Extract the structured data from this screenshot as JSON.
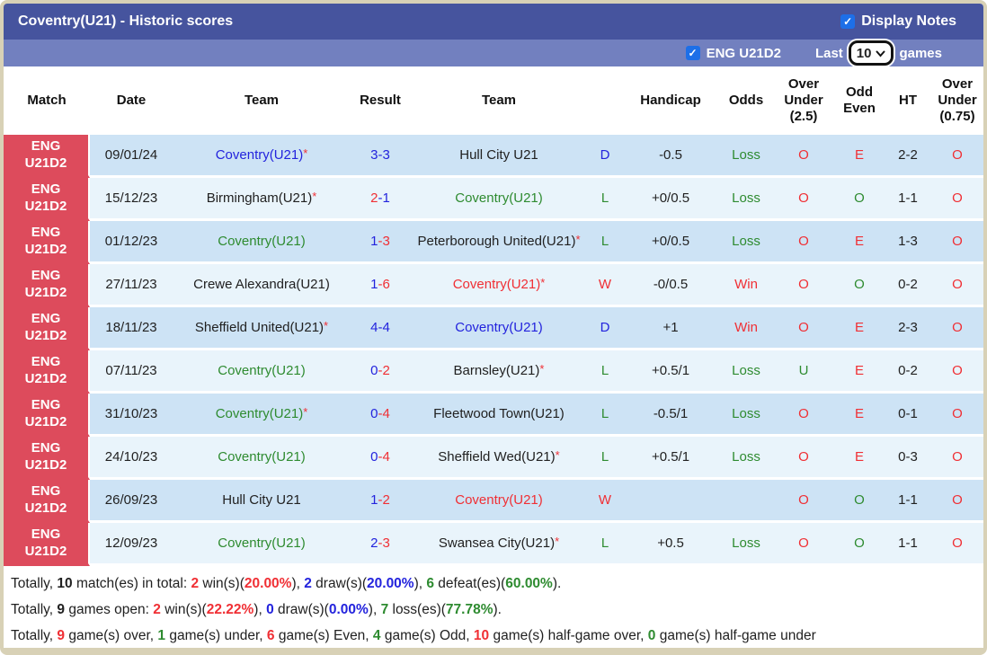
{
  "palette": {
    "red": "#f02f34",
    "green": "#2e8b30",
    "blue": "#2323dd",
    "dark": "#212121",
    "badge_bg": "#dd4b5c",
    "band_dark": "#46549e",
    "band_light": "#7280bf",
    "row_dark": "#cde3f5",
    "row_light": "#e9f4fb",
    "checkbox_blue": "#1d6fe8",
    "border_tan": "#d8d1b6"
  },
  "title_bar": {
    "title": "Coventry(U21) - Historic scores",
    "display_notes_label": "Display Notes",
    "display_notes_checked": true
  },
  "filter_bar": {
    "league_label": "ENG U21D2",
    "league_checked": true,
    "last_label": "Last",
    "games_count": "10",
    "games_label": "games"
  },
  "table": {
    "headers": [
      "Match",
      "Date",
      "Team",
      "Result",
      "Team",
      "",
      "Handicap",
      "Odds",
      "Over\nUnder\n(2.5)",
      "Odd\nEven",
      "HT",
      "Over\nUnder\n(0.75)"
    ],
    "rows": [
      {
        "league": "ENG\nU21D2",
        "date": "09/01/24",
        "home": {
          "name": "Coventry(U21)",
          "color": "blue",
          "star": true
        },
        "score": {
          "h": "3",
          "a": "3",
          "hc": "blue",
          "ac": "blue"
        },
        "away": {
          "name": "Hull City U21",
          "color": "dark",
          "star": false
        },
        "outcome": {
          "t": "D",
          "c": "blue"
        },
        "handicap": "-0.5",
        "odds": {
          "t": "Loss",
          "c": "green"
        },
        "ou25": {
          "t": "O",
          "c": "red"
        },
        "oddeven": {
          "t": "E",
          "c": "red"
        },
        "ht": "2-2",
        "ou075": {
          "t": "O",
          "c": "red"
        },
        "shade": "dark"
      },
      {
        "league": "ENG\nU21D2",
        "date": "15/12/23",
        "home": {
          "name": "Birmingham(U21)",
          "color": "dark",
          "star": true
        },
        "score": {
          "h": "2",
          "a": "1",
          "hc": "red",
          "ac": "blue"
        },
        "away": {
          "name": "Coventry(U21)",
          "color": "green",
          "star": false
        },
        "outcome": {
          "t": "L",
          "c": "green"
        },
        "handicap": "+0/0.5",
        "odds": {
          "t": "Loss",
          "c": "green"
        },
        "ou25": {
          "t": "O",
          "c": "red"
        },
        "oddeven": {
          "t": "O",
          "c": "green"
        },
        "ht": "1-1",
        "ou075": {
          "t": "O",
          "c": "red"
        },
        "shade": "light"
      },
      {
        "league": "ENG\nU21D2",
        "date": "01/12/23",
        "home": {
          "name": "Coventry(U21)",
          "color": "green",
          "star": false
        },
        "score": {
          "h": "1",
          "a": "3",
          "hc": "blue",
          "ac": "red"
        },
        "away": {
          "name": "Peterborough United(U21)",
          "color": "dark",
          "star": true
        },
        "outcome": {
          "t": "L",
          "c": "green"
        },
        "handicap": "+0/0.5",
        "odds": {
          "t": "Loss",
          "c": "green"
        },
        "ou25": {
          "t": "O",
          "c": "red"
        },
        "oddeven": {
          "t": "E",
          "c": "red"
        },
        "ht": "1-3",
        "ou075": {
          "t": "O",
          "c": "red"
        },
        "shade": "dark"
      },
      {
        "league": "ENG\nU21D2",
        "date": "27/11/23",
        "home": {
          "name": "Crewe Alexandra(U21)",
          "color": "dark",
          "star": false
        },
        "score": {
          "h": "1",
          "a": "6",
          "hc": "blue",
          "ac": "red"
        },
        "away": {
          "name": "Coventry(U21)",
          "color": "red",
          "star": true
        },
        "outcome": {
          "t": "W",
          "c": "red"
        },
        "handicap": "-0/0.5",
        "odds": {
          "t": "Win",
          "c": "red"
        },
        "ou25": {
          "t": "O",
          "c": "red"
        },
        "oddeven": {
          "t": "O",
          "c": "green"
        },
        "ht": "0-2",
        "ou075": {
          "t": "O",
          "c": "red"
        },
        "shade": "light"
      },
      {
        "league": "ENG\nU21D2",
        "date": "18/11/23",
        "home": {
          "name": "Sheffield United(U21)",
          "color": "dark",
          "star": true
        },
        "score": {
          "h": "4",
          "a": "4",
          "hc": "blue",
          "ac": "blue"
        },
        "away": {
          "name": "Coventry(U21)",
          "color": "blue",
          "star": false
        },
        "outcome": {
          "t": "D",
          "c": "blue"
        },
        "handicap": "+1",
        "odds": {
          "t": "Win",
          "c": "red"
        },
        "ou25": {
          "t": "O",
          "c": "red"
        },
        "oddeven": {
          "t": "E",
          "c": "red"
        },
        "ht": "2-3",
        "ou075": {
          "t": "O",
          "c": "red"
        },
        "shade": "dark"
      },
      {
        "league": "ENG\nU21D2",
        "date": "07/11/23",
        "home": {
          "name": "Coventry(U21)",
          "color": "green",
          "star": false
        },
        "score": {
          "h": "0",
          "a": "2",
          "hc": "blue",
          "ac": "red"
        },
        "away": {
          "name": "Barnsley(U21)",
          "color": "dark",
          "star": true
        },
        "outcome": {
          "t": "L",
          "c": "green"
        },
        "handicap": "+0.5/1",
        "odds": {
          "t": "Loss",
          "c": "green"
        },
        "ou25": {
          "t": "U",
          "c": "green"
        },
        "oddeven": {
          "t": "E",
          "c": "red"
        },
        "ht": "0-2",
        "ou075": {
          "t": "O",
          "c": "red"
        },
        "shade": "light"
      },
      {
        "league": "ENG\nU21D2",
        "date": "31/10/23",
        "home": {
          "name": "Coventry(U21)",
          "color": "green",
          "star": true
        },
        "score": {
          "h": "0",
          "a": "4",
          "hc": "blue",
          "ac": "red"
        },
        "away": {
          "name": "Fleetwood Town(U21)",
          "color": "dark",
          "star": false
        },
        "outcome": {
          "t": "L",
          "c": "green"
        },
        "handicap": "-0.5/1",
        "odds": {
          "t": "Loss",
          "c": "green"
        },
        "ou25": {
          "t": "O",
          "c": "red"
        },
        "oddeven": {
          "t": "E",
          "c": "red"
        },
        "ht": "0-1",
        "ou075": {
          "t": "O",
          "c": "red"
        },
        "shade": "dark"
      },
      {
        "league": "ENG\nU21D2",
        "date": "24/10/23",
        "home": {
          "name": "Coventry(U21)",
          "color": "green",
          "star": false
        },
        "score": {
          "h": "0",
          "a": "4",
          "hc": "blue",
          "ac": "red"
        },
        "away": {
          "name": "Sheffield Wed(U21)",
          "color": "dark",
          "star": true
        },
        "outcome": {
          "t": "L",
          "c": "green"
        },
        "handicap": "+0.5/1",
        "odds": {
          "t": "Loss",
          "c": "green"
        },
        "ou25": {
          "t": "O",
          "c": "red"
        },
        "oddeven": {
          "t": "E",
          "c": "red"
        },
        "ht": "0-3",
        "ou075": {
          "t": "O",
          "c": "red"
        },
        "shade": "light"
      },
      {
        "league": "ENG\nU21D2",
        "date": "26/09/23",
        "home": {
          "name": "Hull City U21",
          "color": "dark",
          "star": false
        },
        "score": {
          "h": "1",
          "a": "2",
          "hc": "blue",
          "ac": "red"
        },
        "away": {
          "name": "Coventry(U21)",
          "color": "red",
          "star": false
        },
        "outcome": {
          "t": "W",
          "c": "red"
        },
        "handicap": "",
        "odds": {
          "t": "",
          "c": "dark"
        },
        "ou25": {
          "t": "O",
          "c": "red"
        },
        "oddeven": {
          "t": "O",
          "c": "green"
        },
        "ht": "1-1",
        "ou075": {
          "t": "O",
          "c": "red"
        },
        "shade": "dark"
      },
      {
        "league": "ENG\nU21D2",
        "date": "12/09/23",
        "home": {
          "name": "Coventry(U21)",
          "color": "green",
          "star": false
        },
        "score": {
          "h": "2",
          "a": "3",
          "hc": "blue",
          "ac": "red"
        },
        "away": {
          "name": "Swansea City(U21)",
          "color": "dark",
          "star": true
        },
        "outcome": {
          "t": "L",
          "c": "green"
        },
        "handicap": "+0.5",
        "odds": {
          "t": "Loss",
          "c": "green"
        },
        "ou25": {
          "t": "O",
          "c": "red"
        },
        "oddeven": {
          "t": "O",
          "c": "green"
        },
        "ht": "1-1",
        "ou075": {
          "t": "O",
          "c": "red"
        },
        "shade": "light"
      }
    ]
  },
  "summary": {
    "lines": [
      [
        {
          "t": "Totally, "
        },
        {
          "t": "10",
          "b": 1
        },
        {
          "t": " match(es) in total: "
        },
        {
          "t": "2",
          "c": "red",
          "b": 1
        },
        {
          "t": " win(s)("
        },
        {
          "t": "20.00%",
          "c": "red",
          "b": 1
        },
        {
          "t": "), "
        },
        {
          "t": "2",
          "c": "blue",
          "b": 1
        },
        {
          "t": " draw(s)("
        },
        {
          "t": "20.00%",
          "c": "blue",
          "b": 1
        },
        {
          "t": "), "
        },
        {
          "t": "6",
          "c": "green",
          "b": 1
        },
        {
          "t": " defeat(es)("
        },
        {
          "t": "60.00%",
          "c": "green",
          "b": 1
        },
        {
          "t": ")."
        }
      ],
      [
        {
          "t": "Totally, "
        },
        {
          "t": "9",
          "b": 1
        },
        {
          "t": " games open: "
        },
        {
          "t": "2",
          "c": "red",
          "b": 1
        },
        {
          "t": " win(s)("
        },
        {
          "t": "22.22%",
          "c": "red",
          "b": 1
        },
        {
          "t": "), "
        },
        {
          "t": "0",
          "c": "blue",
          "b": 1
        },
        {
          "t": " draw(s)("
        },
        {
          "t": "0.00%",
          "c": "blue",
          "b": 1
        },
        {
          "t": "), "
        },
        {
          "t": "7",
          "c": "green",
          "b": 1
        },
        {
          "t": " loss(es)("
        },
        {
          "t": "77.78%",
          "c": "green",
          "b": 1
        },
        {
          "t": ")."
        }
      ],
      [
        {
          "t": "Totally, "
        },
        {
          "t": "9",
          "c": "red",
          "b": 1
        },
        {
          "t": " game(s) over, "
        },
        {
          "t": "1",
          "c": "green",
          "b": 1
        },
        {
          "t": " game(s) under, "
        },
        {
          "t": "6",
          "c": "red",
          "b": 1
        },
        {
          "t": " game(s) Even, "
        },
        {
          "t": "4",
          "c": "green",
          "b": 1
        },
        {
          "t": " game(s) Odd, "
        },
        {
          "t": "10",
          "c": "red",
          "b": 1
        },
        {
          "t": " game(s) half-game over, "
        },
        {
          "t": "0",
          "c": "green",
          "b": 1
        },
        {
          "t": " game(s) half-game under"
        }
      ]
    ]
  }
}
